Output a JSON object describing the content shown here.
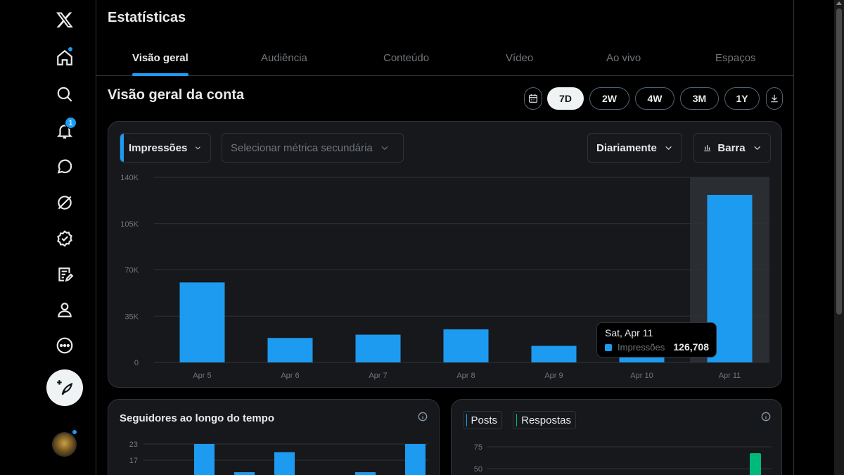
{
  "header": {
    "title": "Estatísticas"
  },
  "tabs": [
    {
      "label": "Visão geral",
      "active": true
    },
    {
      "label": "Audiência"
    },
    {
      "label": "Conteúdo"
    },
    {
      "label": "Vídeo"
    },
    {
      "label": "Ao vivo"
    },
    {
      "label": "Espaços"
    }
  ],
  "sidebar": {
    "items": [
      {
        "icon": "x-logo-icon"
      },
      {
        "icon": "home-icon",
        "dot": true
      },
      {
        "icon": "search-icon"
      },
      {
        "icon": "notifications-icon",
        "badge": "1"
      },
      {
        "icon": "messages-icon"
      },
      {
        "icon": "grok-icon"
      },
      {
        "icon": "verified-icon"
      },
      {
        "icon": "articles-icon"
      },
      {
        "icon": "profile-icon"
      },
      {
        "icon": "more-icon"
      }
    ],
    "post_button_icon": "compose-icon",
    "avatar_dot": true
  },
  "overview": {
    "title": "Visão geral da conta",
    "ranges": [
      "7D",
      "2W",
      "4W",
      "3M",
      "1Y"
    ],
    "active_range": "7D",
    "calendar_icon": "calendar-icon",
    "download_icon": "download-icon"
  },
  "controls": {
    "primary_metric": "Impressões",
    "secondary_metric_placeholder": "Selecionar métrica secundária",
    "interval": "Diariamente",
    "chart_type": "Barra"
  },
  "tooltip": {
    "date": "Sat, Apr 11",
    "metric": "Impressões",
    "value": "126,708"
  },
  "chart_data": [
    {
      "type": "bar",
      "categories": [
        "Apr 5",
        "Apr 6",
        "Apr 7",
        "Apr 8",
        "Apr 9",
        "Apr 10",
        "Apr 11"
      ],
      "series": [
        {
          "name": "Impressões",
          "values": [
            60500,
            18500,
            21000,
            25000,
            12500,
            9000,
            126708
          ],
          "color": "#1d9bf0"
        }
      ],
      "ylim": [
        0,
        140000
      ],
      "yticks": [
        0,
        35000,
        70000,
        105000,
        140000
      ],
      "ytick_labels": [
        "0",
        "35K",
        "70K",
        "105K",
        "140K"
      ],
      "highlight_category": "Apr 11",
      "grid": true
    },
    {
      "type": "bar",
      "title": "Seguidores ao longo do tempo",
      "yticks": [
        17,
        23
      ],
      "ytick_labels": [
        "17",
        "23"
      ],
      "values_visible": [
        23,
        1,
        1,
        20,
        0,
        1,
        23
      ]
    },
    {
      "type": "bar",
      "series": [
        {
          "name": "Posts",
          "color": "#1d9bf0"
        },
        {
          "name": "Respostas",
          "color": "#00ba7c"
        }
      ],
      "yticks": [
        50,
        75
      ],
      "ytick_labels": [
        "50",
        "75"
      ]
    }
  ],
  "followers_card": {
    "title": "Seguidores ao longo do tempo"
  },
  "posts_card": {
    "legend": [
      "Posts",
      "Respostas"
    ]
  }
}
